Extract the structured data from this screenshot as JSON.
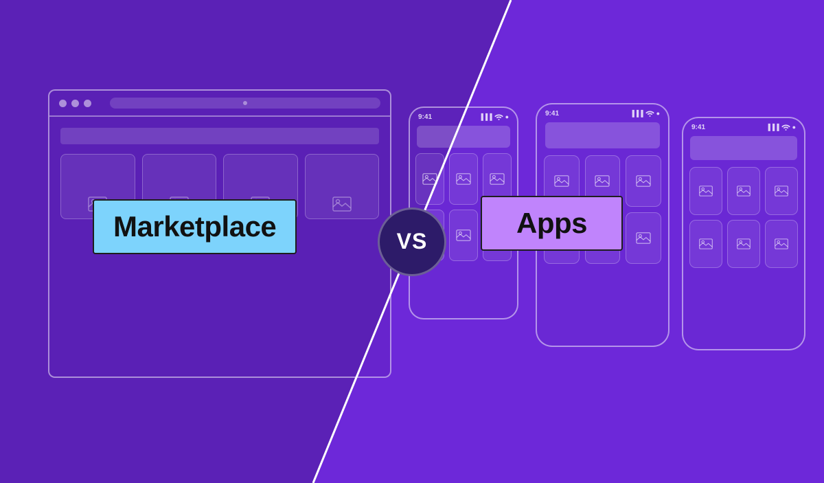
{
  "layout": {
    "background_left": "#5b21b6",
    "background_right": "#6d28d9",
    "vs_text": "VS"
  },
  "left_side": {
    "label": "Marketplace",
    "label_bg": "#7dd3fc",
    "browser": {
      "dots": [
        "circle",
        "circle",
        "circle"
      ],
      "cards_count": 4
    }
  },
  "right_side": {
    "label": "Apps",
    "label_bg": "#c084fc",
    "phones_count": 3
  },
  "icons": {
    "image_icon": "🖼",
    "signal_icon": "▐▐▐",
    "wifi_icon": "wifi",
    "battery_icon": "●"
  },
  "phone_times": [
    "9:41",
    "9:41",
    "9:41"
  ]
}
